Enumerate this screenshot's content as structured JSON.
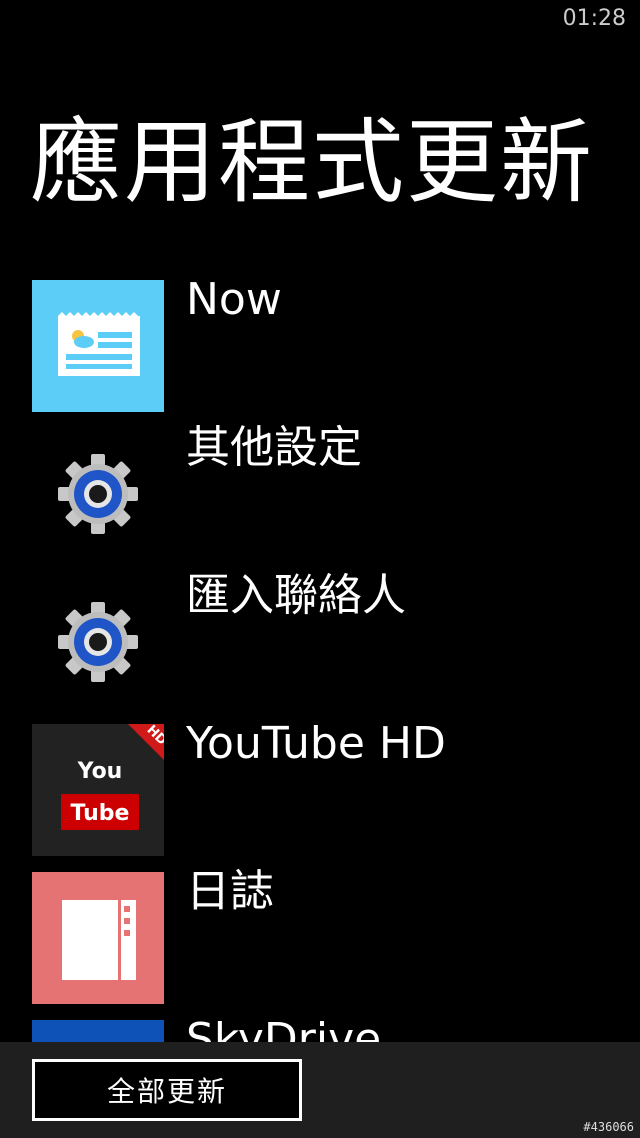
{
  "status_bar": {
    "time": "01:28"
  },
  "page": {
    "title": "應用程式更新"
  },
  "updates": [
    {
      "label": "Now",
      "icon": "news-weather-icon",
      "tile_color": "#5ccdf6"
    },
    {
      "label": "其他設定",
      "icon": "gear-icon",
      "tile_color": ""
    },
    {
      "label": "匯入聯絡人",
      "icon": "gear-icon",
      "tile_color": ""
    },
    {
      "label": "YouTube HD",
      "icon": "youtube-hd-icon",
      "tile_color": "#222222",
      "logo_top": "You",
      "logo_bottom": "Tube",
      "badge": "HD"
    },
    {
      "label": "日誌",
      "icon": "journal-icon",
      "tile_color": "#e57373"
    },
    {
      "label": "SkyDrive",
      "icon": "skydrive-icon",
      "tile_color": "#0e52b8"
    }
  ],
  "bottom_bar": {
    "update_all_label": "全部更新"
  },
  "watermark": "#436066"
}
